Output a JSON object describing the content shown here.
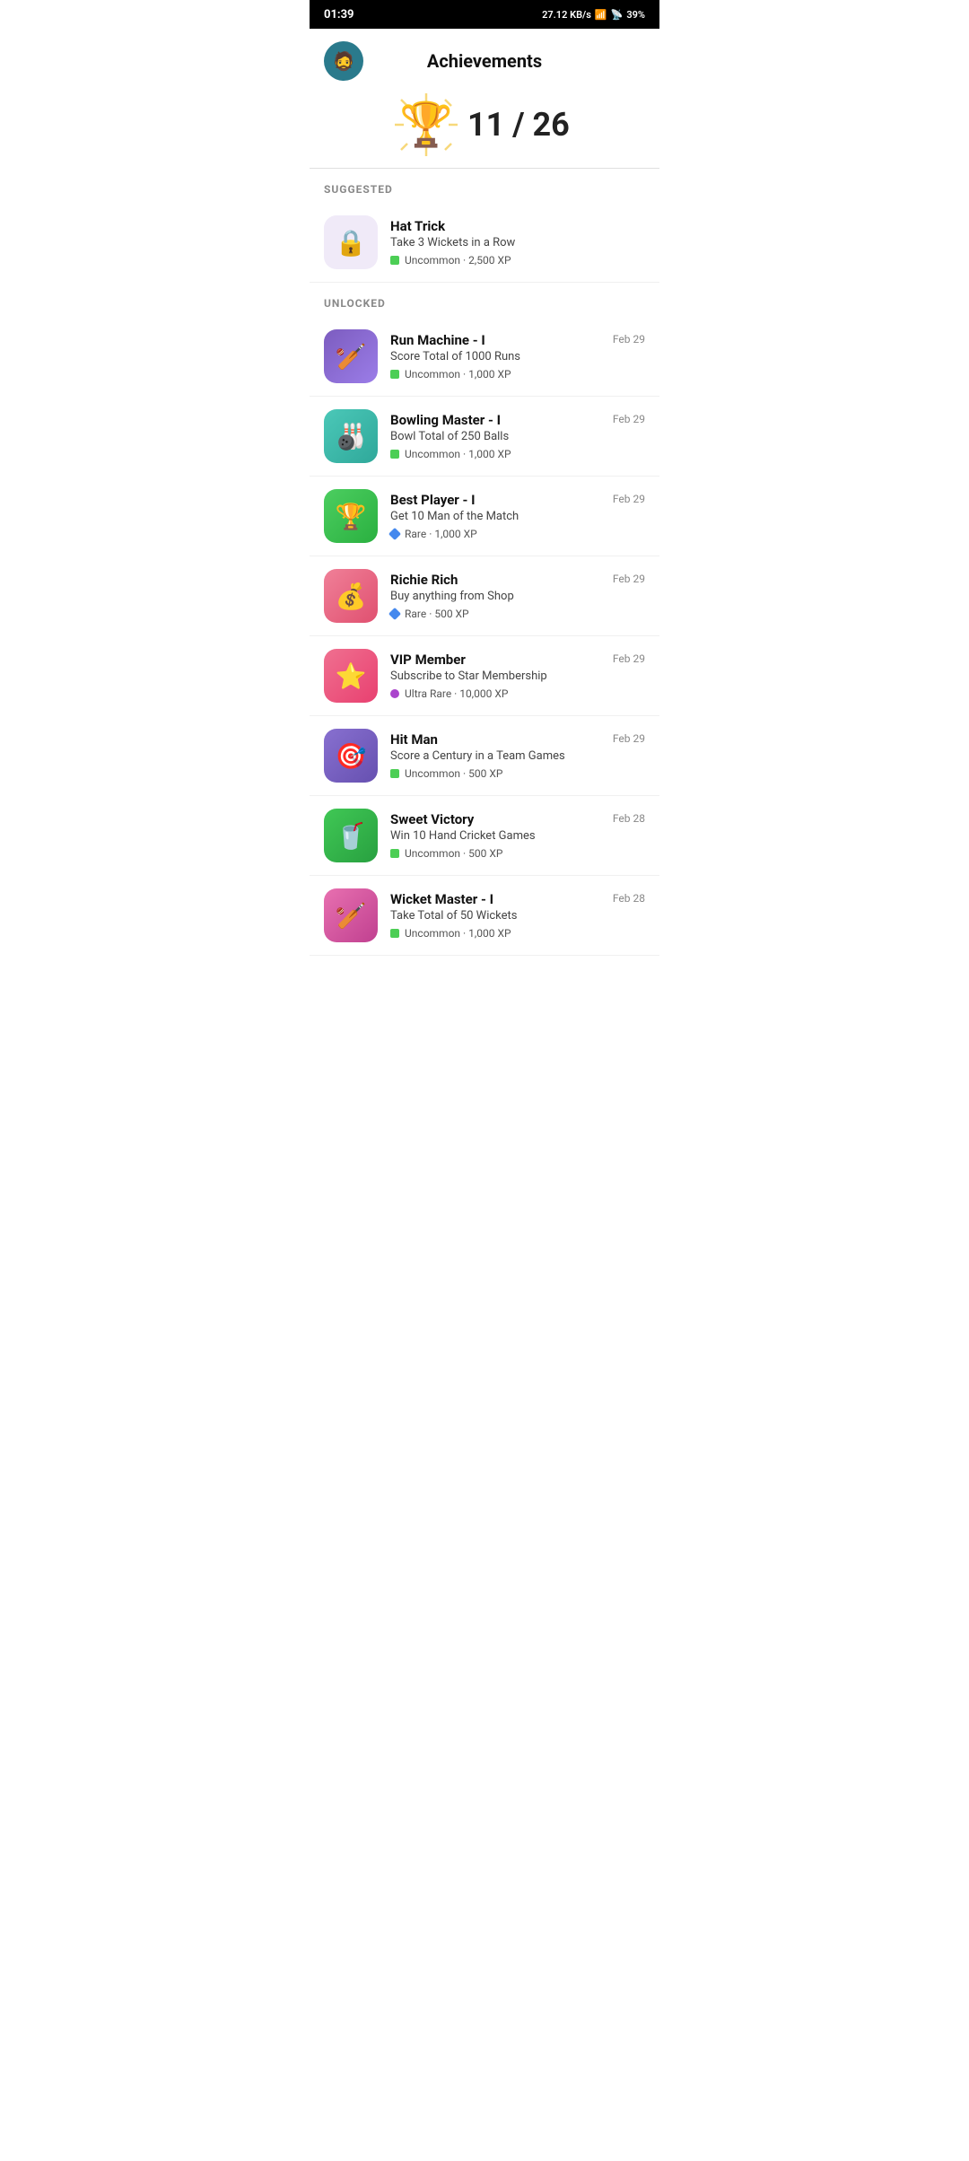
{
  "statusBar": {
    "time": "01:39",
    "network": "27.12 KB/s",
    "battery": "39%"
  },
  "header": {
    "title": "Achievements",
    "avatar_emoji": "🧔"
  },
  "trophy": {
    "current": "11",
    "total": "26",
    "display": "11 / 26"
  },
  "sections": [
    {
      "id": "suggested",
      "label": "SUGGESTED",
      "items": [
        {
          "id": "hat-trick",
          "name": "Hat Trick",
          "desc": "Take 3 Wickets in a Row",
          "rarity": "Uncommon",
          "xp": "2,500 XP",
          "rarity_type": "uncommon",
          "icon_type": "locked",
          "icon_emoji": "🔒",
          "date": ""
        }
      ]
    },
    {
      "id": "unlocked",
      "label": "UNLOCKED",
      "items": [
        {
          "id": "run-machine",
          "name": "Run Machine - I",
          "desc": "Score Total of 1000 Runs",
          "rarity": "Uncommon",
          "xp": "1,000 XP",
          "rarity_type": "uncommon",
          "icon_type": "purple",
          "icon_emoji": "🏏",
          "date": "Feb 29"
        },
        {
          "id": "bowling-master",
          "name": "Bowling Master - I",
          "desc": "Bowl Total of 250 Balls",
          "rarity": "Uncommon",
          "xp": "1,000 XP",
          "rarity_type": "uncommon",
          "icon_type": "teal",
          "icon_emoji": "🎳",
          "date": "Feb 29"
        },
        {
          "id": "best-player",
          "name": "Best Player - I",
          "desc": "Get 10 Man of the Match",
          "rarity": "Rare",
          "xp": "1,000 XP",
          "rarity_type": "rare",
          "icon_type": "green",
          "icon_emoji": "🏆",
          "date": "Feb 29"
        },
        {
          "id": "richie-rich",
          "name": "Richie Rich",
          "desc": "Buy anything from Shop",
          "rarity": "Rare",
          "xp": "500 XP",
          "rarity_type": "rare",
          "icon_type": "pink",
          "icon_emoji": "💰",
          "date": "Feb 29"
        },
        {
          "id": "vip-member",
          "name": "VIP Member",
          "desc": "Subscribe to Star Membership",
          "rarity": "Ultra Rare",
          "xp": "10,000 XP",
          "rarity_type": "ultra-rare",
          "icon_type": "pink2",
          "icon_emoji": "⭐",
          "date": "Feb 29"
        },
        {
          "id": "hit-man",
          "name": "Hit Man",
          "desc": "Score a Century in a Team Games",
          "rarity": "Uncommon",
          "xp": "500 XP",
          "rarity_type": "uncommon",
          "icon_type": "purple2",
          "icon_emoji": "🎯",
          "date": "Feb 29"
        },
        {
          "id": "sweet-victory",
          "name": "Sweet Victory",
          "desc": "Win 10 Hand Cricket Games",
          "rarity": "Uncommon",
          "xp": "500 XP",
          "rarity_type": "uncommon",
          "icon_type": "green2",
          "icon_emoji": "🥤",
          "date": "Feb 28"
        },
        {
          "id": "wicket-master",
          "name": "Wicket Master - I",
          "desc": "Take Total of 50 Wickets",
          "rarity": "Uncommon",
          "xp": "1,000 XP",
          "rarity_type": "uncommon",
          "icon_type": "pink3",
          "icon_emoji": "🏏",
          "date": "Feb 28"
        }
      ]
    }
  ],
  "rarity_colors": {
    "uncommon": "#4cce55",
    "rare": "#4488ee",
    "ultra_rare": "#aa44cc"
  }
}
